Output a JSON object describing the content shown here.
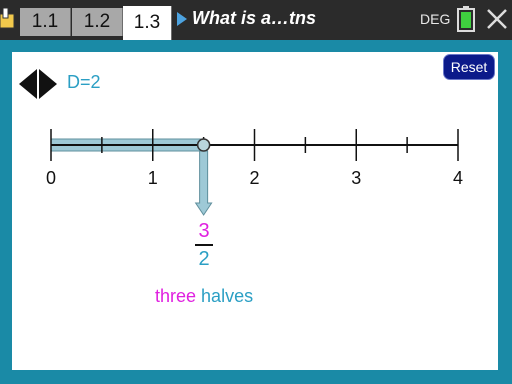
{
  "header": {
    "tabs": [
      {
        "label": "1.1"
      },
      {
        "label": "1.2"
      },
      {
        "label": "1.3"
      }
    ],
    "document_title": "What is a…tns",
    "angle_mode": "DEG"
  },
  "panel": {
    "reset_label": "Reset",
    "denominator_label": "D=2",
    "number_line": {
      "tick_labels": [
        "0",
        "1",
        "2",
        "3",
        "4"
      ],
      "range": [
        0,
        4
      ],
      "denominator": 2,
      "point_value": 1.5
    },
    "fraction": {
      "numerator": "3",
      "denominator": "2"
    },
    "fraction_words": {
      "numerator_word": "three",
      "denominator_word": "halves"
    }
  },
  "colors": {
    "numerator": "#e020e0",
    "denominator": "#2b9fc4",
    "segment_fill": "#9ec9d6",
    "reset_button": "#0b1a8a"
  }
}
